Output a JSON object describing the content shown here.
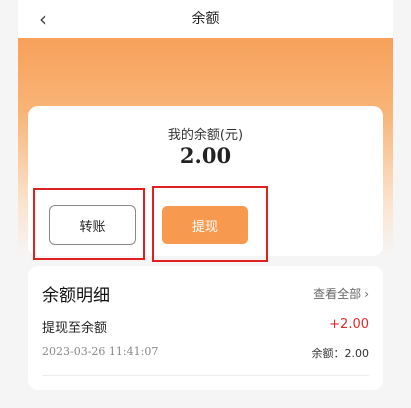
{
  "header": {
    "title": "余额"
  },
  "balance": {
    "label": "我的余额(元)",
    "amount": "2.00"
  },
  "actions": {
    "transfer_label": "转账",
    "withdraw_label": "提现"
  },
  "details": {
    "title": "余额明细",
    "view_all_label": "查看全部",
    "items": [
      {
        "title": "提现至余额",
        "amount": "+2.00",
        "time": "2023-03-26 11:41:07",
        "balance": "余额：2.00"
      }
    ]
  },
  "colors": {
    "accent": "#f79a4f",
    "positive_amount": "#e22b2b",
    "highlight_box": "#e0211f"
  }
}
